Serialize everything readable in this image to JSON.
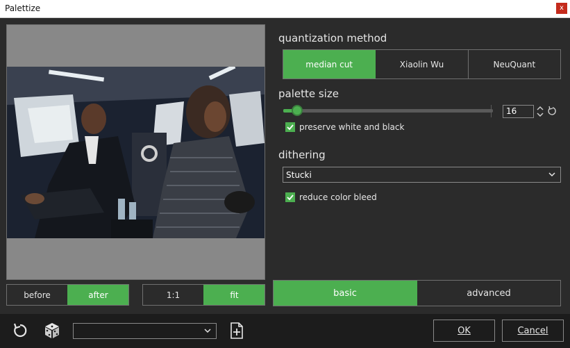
{
  "window": {
    "title": "Palettize",
    "close_glyph": "x"
  },
  "preview": {
    "view_toggle": {
      "before": "before",
      "after": "after",
      "active": "after"
    },
    "zoom_toggle": {
      "one_to_one": "1:1",
      "fit": "fit",
      "active": "fit"
    }
  },
  "quantization": {
    "label": "quantization method",
    "options": [
      "median cut",
      "Xiaolin Wu",
      "NeuQuant"
    ],
    "selected": "median cut"
  },
  "palette_size": {
    "label": "palette size",
    "value": "16",
    "slider_fraction": 0.06,
    "preserve_label": "preserve white and black",
    "preserve_checked": true
  },
  "dithering": {
    "label": "dithering",
    "selected": "Stucki",
    "reduce_bleed_label": "reduce color bleed",
    "reduce_bleed_checked": true
  },
  "mode_tabs": {
    "basic": "basic",
    "advanced": "advanced",
    "active": "basic"
  },
  "footer": {
    "ok_label": "OK",
    "cancel_label": "Cancel",
    "preset_value": ""
  },
  "icons": {
    "reset": "reset-icon",
    "random": "dice-icon",
    "new_preset": "new-file-icon",
    "spin": "spin-arrows-icon",
    "slider_reset": "reset-icon",
    "chevron": "chevron-down-icon",
    "check": "check-icon"
  },
  "colors": {
    "accent": "#4caf50",
    "background": "#2b2b2b",
    "footer": "#1c1c1c",
    "preview_bg": "#888888"
  }
}
